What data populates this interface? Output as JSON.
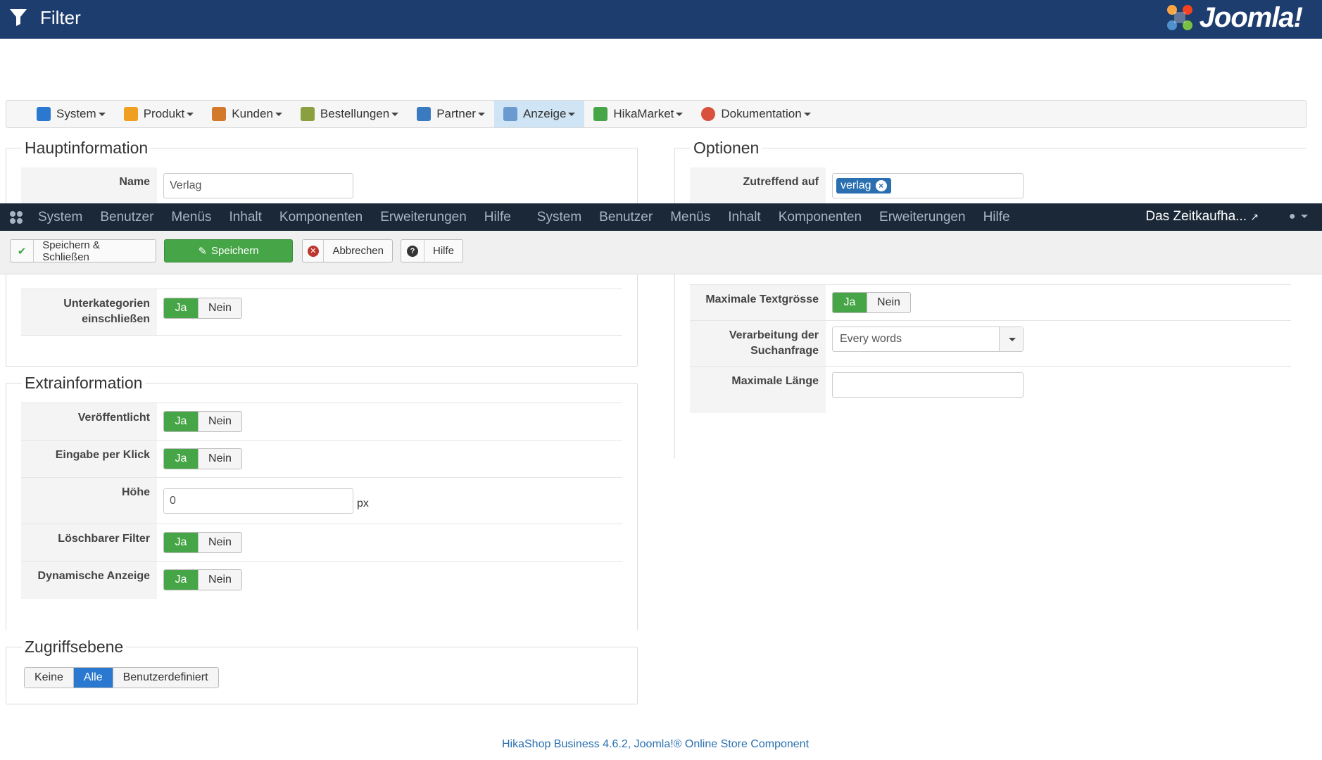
{
  "header": {
    "title": "Filter",
    "logo_text": "Joomla!"
  },
  "hika_menu": [
    {
      "label": "System",
      "icon": "wrench-icon",
      "color": "#2a78d0"
    },
    {
      "label": "Produkt",
      "icon": "box-icon",
      "color": "#f0a020"
    },
    {
      "label": "Kunden",
      "icon": "users-icon",
      "color": "#d27a2a"
    },
    {
      "label": "Bestellungen",
      "icon": "orders-icon",
      "color": "#8aa040"
    },
    {
      "label": "Partner",
      "icon": "partner-icon",
      "color": "#3a7ac0"
    },
    {
      "label": "Anzeige",
      "icon": "display-icon",
      "color": "#6a9ad0",
      "active": true
    },
    {
      "label": "HikaMarket",
      "icon": "market-icon",
      "color": "#46a546"
    },
    {
      "label": "Dokumentation",
      "icon": "lifebuoy-icon",
      "color": "#d9503f"
    }
  ],
  "main": {
    "legend": "Hauptinformation",
    "name_label": "Name",
    "name_value": "Verlag",
    "subcat_label_1": "Unterkategorien",
    "subcat_label_2": "einschließen"
  },
  "options": {
    "legend": "Optionen",
    "applies_label": "Zutreffend auf",
    "applies_tag": "verlag",
    "max_text_label": "Maximale Textgrösse",
    "query_label_1": "Verarbeitung der",
    "query_label_2": "Suchanfrage",
    "query_value": "Every words",
    "max_len_label": "Maximale Länge",
    "max_len_value": ""
  },
  "extra": {
    "legend": "Extrainformation",
    "published_label": "Veröffentlicht",
    "click_label": "Eingabe per Klick",
    "height_label": "Höhe",
    "height_value": "0",
    "height_unit": "px",
    "deletable_label": "Löschbarer Filter",
    "dynamic_label": "Dynamische Anzeige"
  },
  "toggle": {
    "yes": "Ja",
    "no": "Nein"
  },
  "adminbar": {
    "nav": [
      "System",
      "Benutzer",
      "Menüs",
      "Inhalt",
      "Komponenten",
      "Erweiterungen",
      "Hilfe",
      "System",
      "Benutzer",
      "Menüs",
      "Inhalt",
      "Komponenten",
      "Erweiterungen",
      "Hilfe"
    ],
    "site_name": "Das Zeitkaufha..."
  },
  "toolbar": {
    "save_close": "Speichern & Schließen",
    "save": "Speichern",
    "cancel": "Abbrechen",
    "help": "Hilfe"
  },
  "access": {
    "legend": "Zugriffsebene",
    "options": [
      "Keine",
      "Alle",
      "Benutzerdefiniert"
    ],
    "selected": "Alle"
  },
  "footer": "HikaShop Business 4.6.2, Joomla!® Online Store Component",
  "colors": {
    "header_bg": "#1c3d6e",
    "adminbar_bg": "#1b2838",
    "green": "#46a546",
    "blue": "#2a78d0"
  }
}
